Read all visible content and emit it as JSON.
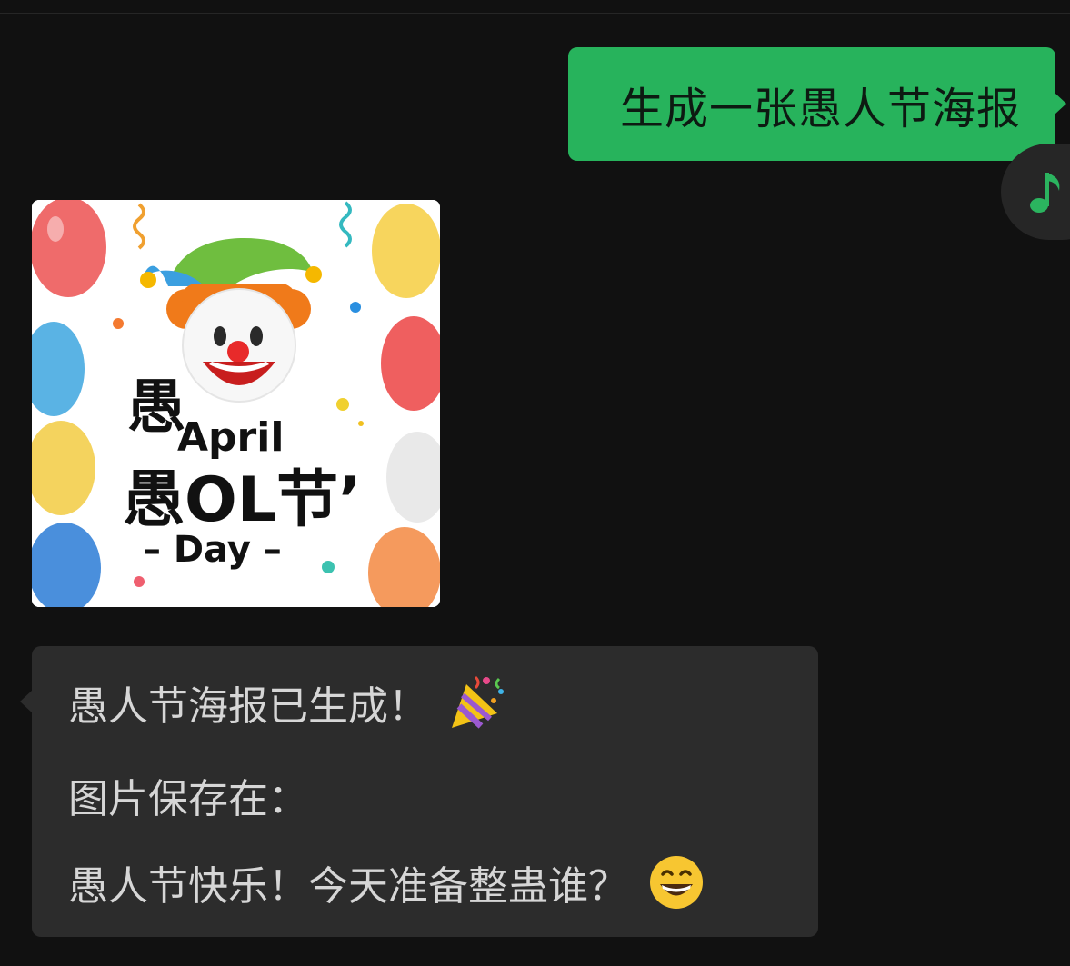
{
  "chat": {
    "outgoing_message": "生成一张愚人节海报",
    "tts_button_icon": "music-note-icon",
    "image": {
      "poster_text": {
        "line1": "愚",
        "line2": "April",
        "line3": "愚OL节’",
        "line4": "– Day –"
      }
    },
    "reply": {
      "line1": "愚人节海报已生成！",
      "line1_emoji": "party-popper-icon",
      "line2": "图片保存在：",
      "line3": "愚人节快乐！今天准备整蛊谁？",
      "line3_emoji": "grinning-face-icon"
    }
  },
  "colors": {
    "background": "#111111",
    "outgoing_bubble": "#27b35c",
    "incoming_bubble": "#2c2c2c",
    "incoming_text": "#d6d6d6",
    "accent_icon": "#2bb45f"
  }
}
